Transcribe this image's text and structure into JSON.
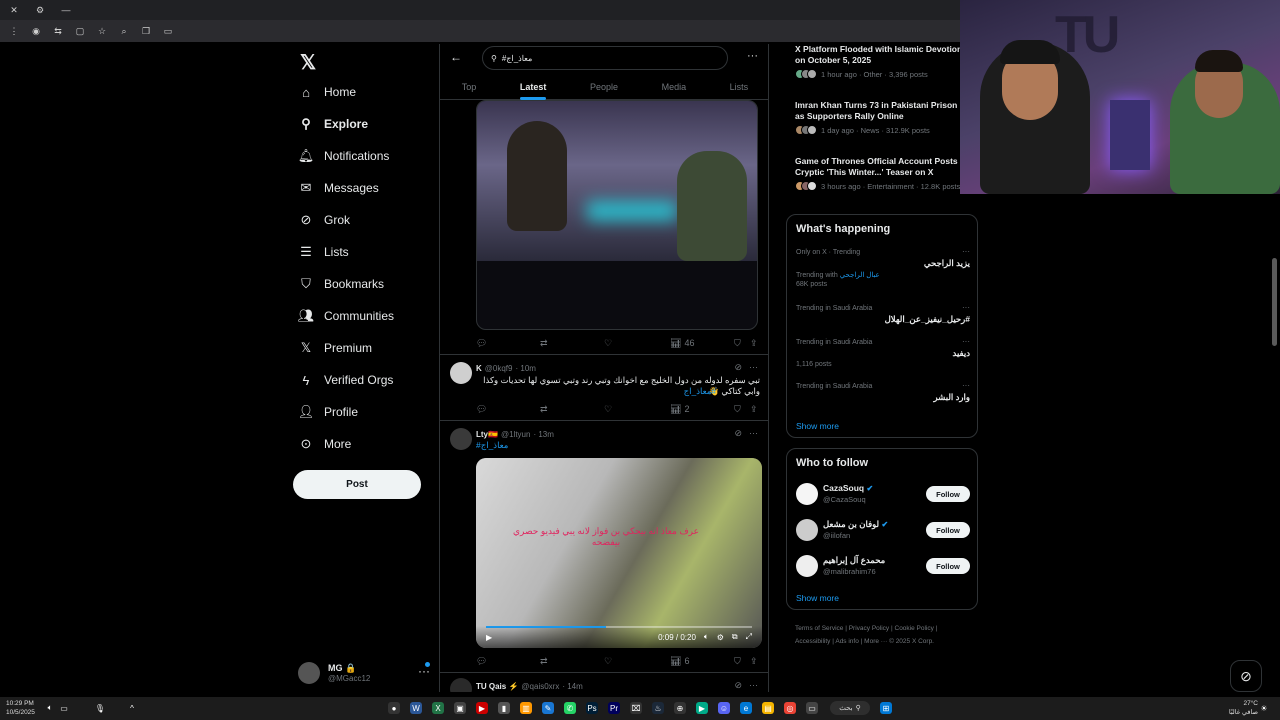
{
  "browser": {
    "titlebar_icons": [
      "close-icon",
      "settings-icon",
      "minimize-icon"
    ],
    "toolbar_icons": [
      "menu-icon",
      "extension-icon",
      "translate-icon",
      "tab-icon",
      "star-icon",
      "pin-icon",
      "copy-icon",
      "screen-icon"
    ]
  },
  "nav": {
    "items": [
      {
        "label": "Home",
        "icon": "home-icon"
      },
      {
        "label": "Explore",
        "icon": "search-icon"
      },
      {
        "label": "Notifications",
        "icon": "bell-icon"
      },
      {
        "label": "Messages",
        "icon": "mail-icon"
      },
      {
        "label": "Grok",
        "icon": "grok-icon"
      },
      {
        "label": "Lists",
        "icon": "list-icon"
      },
      {
        "label": "Bookmarks",
        "icon": "bookmark-icon"
      },
      {
        "label": "Communities",
        "icon": "people-icon"
      },
      {
        "label": "Premium",
        "icon": "x-icon"
      },
      {
        "label": "Verified Orgs",
        "icon": "lightning-icon"
      },
      {
        "label": "Profile",
        "icon": "user-icon"
      },
      {
        "label": "More",
        "icon": "more-circle-icon"
      }
    ],
    "post_label": "Post",
    "account": {
      "name": "MG 🔒",
      "handle": "@MGacc12"
    }
  },
  "search": {
    "query": "#معاذ_اج",
    "tabs": [
      "Top",
      "Latest",
      "People",
      "Media",
      "Lists"
    ],
    "active_tab": "Latest"
  },
  "timeline": {
    "tweet0_actions": {
      "views": "46"
    },
    "tweet1": {
      "name": "K",
      "handle": "@0kqf9",
      "time": "· 10m",
      "text": "تبي سفره لدوله من دول الخليج مع اخوانك وتبي رند وتبي تسوي لها تحديات وكذا وابي كتاكي 👋",
      "hashtag": "#معاذ_اج",
      "views": "2"
    },
    "tweet2": {
      "name": "Lty🇪🇸",
      "handle": "@1ltyun",
      "time": "· 13m",
      "hashtag": "#معاذ_اج",
      "video_caption": "عرف معاذ انه بيحكي بن فواز لانه يبي فيديو حصري بيفضحه",
      "video_time": "0:09 / 0:20",
      "video_progress": 0.45,
      "views": "6"
    },
    "tweet3": {
      "name": "TU Qais ⚡",
      "handle": "@qais0xrx",
      "time": "· 14m"
    }
  },
  "news": [
    {
      "title": "X Platform Flooded with Islamic Devotion on October 5, 2025",
      "meta": "1 hour ago · Other · 3,396 posts"
    },
    {
      "title": "Imran Khan Turns 73 in Pakistani Prison as Supporters Rally Online",
      "meta": "1 day ago · News · 312.9K posts"
    },
    {
      "title": "Game of Thrones Official Account Posts Cryptic 'This Winter...' Teaser on X",
      "meta": "3 hours ago · Entertainment · 12.8K posts"
    }
  ],
  "happening": {
    "title": "What's happening",
    "trends": [
      {
        "context": "Only on X · Trending",
        "name": "يزيد الراجحي",
        "extra_prefix": "Trending with ",
        "extra_link": "عبال الراجحي",
        "extra2": "68K posts"
      },
      {
        "context": "Trending in Saudi Arabia",
        "name": "#رحيل_نيفيز_عن_الهلال"
      },
      {
        "context": "Trending in Saudi Arabia",
        "name": "ديفيد",
        "extra2": "1,116 posts"
      },
      {
        "context": "Trending in Saudi Arabia",
        "name": "وارد البشر"
      }
    ],
    "show_more": "Show more"
  },
  "who_to_follow": {
    "title": "Who to follow",
    "users": [
      {
        "name": "CazaSouq",
        "handle": "@CazaSouq",
        "verified": true
      },
      {
        "name": "لوفان بن مشعل",
        "handle": "@iilofan",
        "verified": true
      },
      {
        "name": "محمدع آل إبراهيم",
        "handle": "@malibrahim76",
        "verified": false
      }
    ],
    "follow_label": "Follow",
    "show_more": "Show more"
  },
  "footer": {
    "links": [
      "Terms of Service",
      "Privacy Policy",
      "Cookie Policy",
      "Accessibility",
      "Ads info",
      "More ···"
    ],
    "copyright": "© 2025 X Corp."
  },
  "taskbar": {
    "time": "10:29 PM",
    "date": "10/5/2025",
    "search_label": "بحث",
    "weather": "27°C",
    "weather_desc": "صافي غالبًا"
  },
  "colors": {
    "accent": "#1d9bf0",
    "background": "#000000",
    "border": "#2f3336",
    "muted": "#71767b"
  }
}
